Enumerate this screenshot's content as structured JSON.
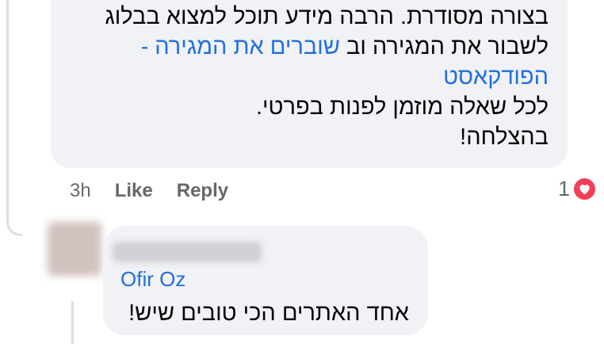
{
  "comment": {
    "lines": [
      "בצורה מסודרת. הרבה מידע תוכל למצוא בבלוג",
      "לשבור את המגירה וב",
      "שוברים את המגירה -",
      "הפודקאסט",
      "לכל שאלה מוזמן לפנות בפרטי.",
      "בהצלחה!"
    ],
    "time": "3h",
    "like_label": "Like",
    "reply_label": "Reply",
    "reaction_count": "1",
    "reaction_icon": "heart-icon"
  },
  "reply": {
    "tagged_name": "Ofir Oz",
    "text": "אחד האתרים הכי טובים שיש!"
  },
  "colors": {
    "bubble": "#f0f2f5",
    "link": "#216fdb",
    "meta": "#65676b",
    "heart": "#f33e58"
  }
}
